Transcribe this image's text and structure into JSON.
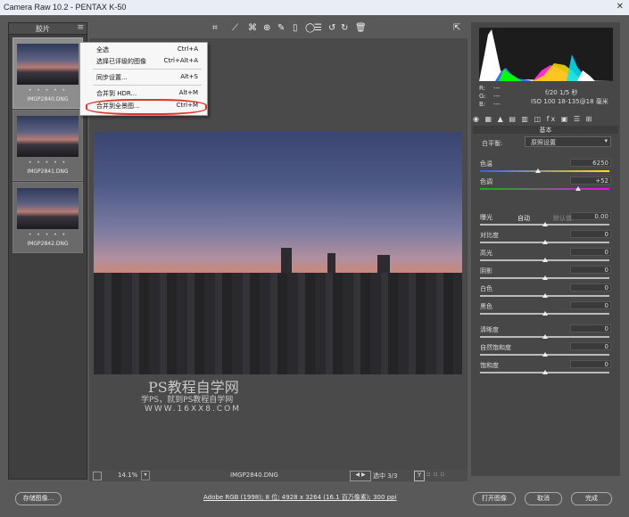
{
  "window": {
    "title": "Camera Raw 10.2 -  PENTAX K-50",
    "close": "✕"
  },
  "filmstrip": {
    "header": "胶片",
    "menu_icon": "≡",
    "items": [
      {
        "stars": "• • • • •",
        "name": "IMGP2840.DNG",
        "selected": true
      },
      {
        "stars": "• • • • •",
        "name": "IMGP2841.DNG",
        "selected": false
      },
      {
        "stars": "• • • • •",
        "name": "IMGP2842.DNG",
        "selected": false
      }
    ]
  },
  "menu": {
    "items": [
      {
        "label": "全选",
        "shortcut": "Ctrl+A"
      },
      {
        "label": "选择已评级的图像",
        "shortcut": "Ctrl+Alt+A"
      },
      {
        "label": "同步设置...",
        "shortcut": "Alt+S"
      },
      {
        "label": "合并到 HDR...",
        "shortcut": "Alt+M"
      },
      {
        "label": "合并到全景图...",
        "shortcut": "Ctrl+M"
      }
    ]
  },
  "toolbar": {
    "icons": [
      "crop-icon",
      "straighten-icon",
      "spot-removal-icon",
      "redeye-icon",
      "brush-icon",
      "graduated-filter-icon",
      "radial-filter-icon",
      "list-icon",
      "rotate-left-icon",
      "rotate-right-icon",
      "trash-icon",
      "fullscreen-icon"
    ],
    "glyphs": [
      "⌗",
      "⟋",
      "⌘",
      "⊕",
      "✎",
      "▯",
      "◯",
      "☰",
      "↺",
      "↻",
      "🗑",
      "⇱"
    ]
  },
  "watermark": {
    "line1": "PS教程自学网",
    "line2": "学PS，就到PS教程自学网",
    "line3": "WWW.16XX8.COM"
  },
  "canvas_footer": {
    "zoom": "14.1%",
    "zoom_caret": "▾",
    "filename": "IMGP2840.DNG",
    "nav": "◀ ▶",
    "selected": "选中 3/3",
    "y_label": "Y",
    "compare": "▫▫▫"
  },
  "histogram": {
    "colors": [
      "#ffffff",
      "#00ff00",
      "#3a6bff",
      "#ff2bd6",
      "#ffe100",
      "#00e5ff"
    ]
  },
  "info": {
    "r": "R:",
    "g": "G:",
    "b": "B:",
    "dash": "---",
    "aperture_shutter": "f/20  1/5 秒",
    "iso_lens": "ISO 100   18-135@18 毫米"
  },
  "panel_tabs": "◉ ▦ ▲ ▤ ▥ ◫ fx ▣ ☰ ⊞",
  "panel": {
    "section": "基本",
    "white_balance_label": "白平衡:",
    "white_balance_value": "原照设置",
    "auto": "自动",
    "default": "默认值",
    "sliders": [
      {
        "label": "色温",
        "value": "6250",
        "pos": 0.45
      },
      {
        "label": "色调",
        "value": "+52",
        "pos": 0.76
      },
      {
        "label": "曝光",
        "value": "0.00",
        "pos": 0.5
      },
      {
        "label": "对比度",
        "value": "0",
        "pos": 0.5
      },
      {
        "label": "高光",
        "value": "0",
        "pos": 0.5
      },
      {
        "label": "阴影",
        "value": "0",
        "pos": 0.5
      },
      {
        "label": "白色",
        "value": "0",
        "pos": 0.5
      },
      {
        "label": "黑色",
        "value": "0",
        "pos": 0.5
      },
      {
        "label": "清晰度",
        "value": "0",
        "pos": 0.5
      },
      {
        "label": "自然饱和度",
        "value": "0",
        "pos": 0.5
      },
      {
        "label": "饱和度",
        "value": "0",
        "pos": 0.5
      }
    ]
  },
  "bottom": {
    "save": "存储图像...",
    "workflow": "Adobe RGB (1998); 8 位; 4928 x 3264 (16.1 百万像素); 300 ppi",
    "open": "打开图像",
    "cancel": "取消",
    "done": "完成"
  }
}
